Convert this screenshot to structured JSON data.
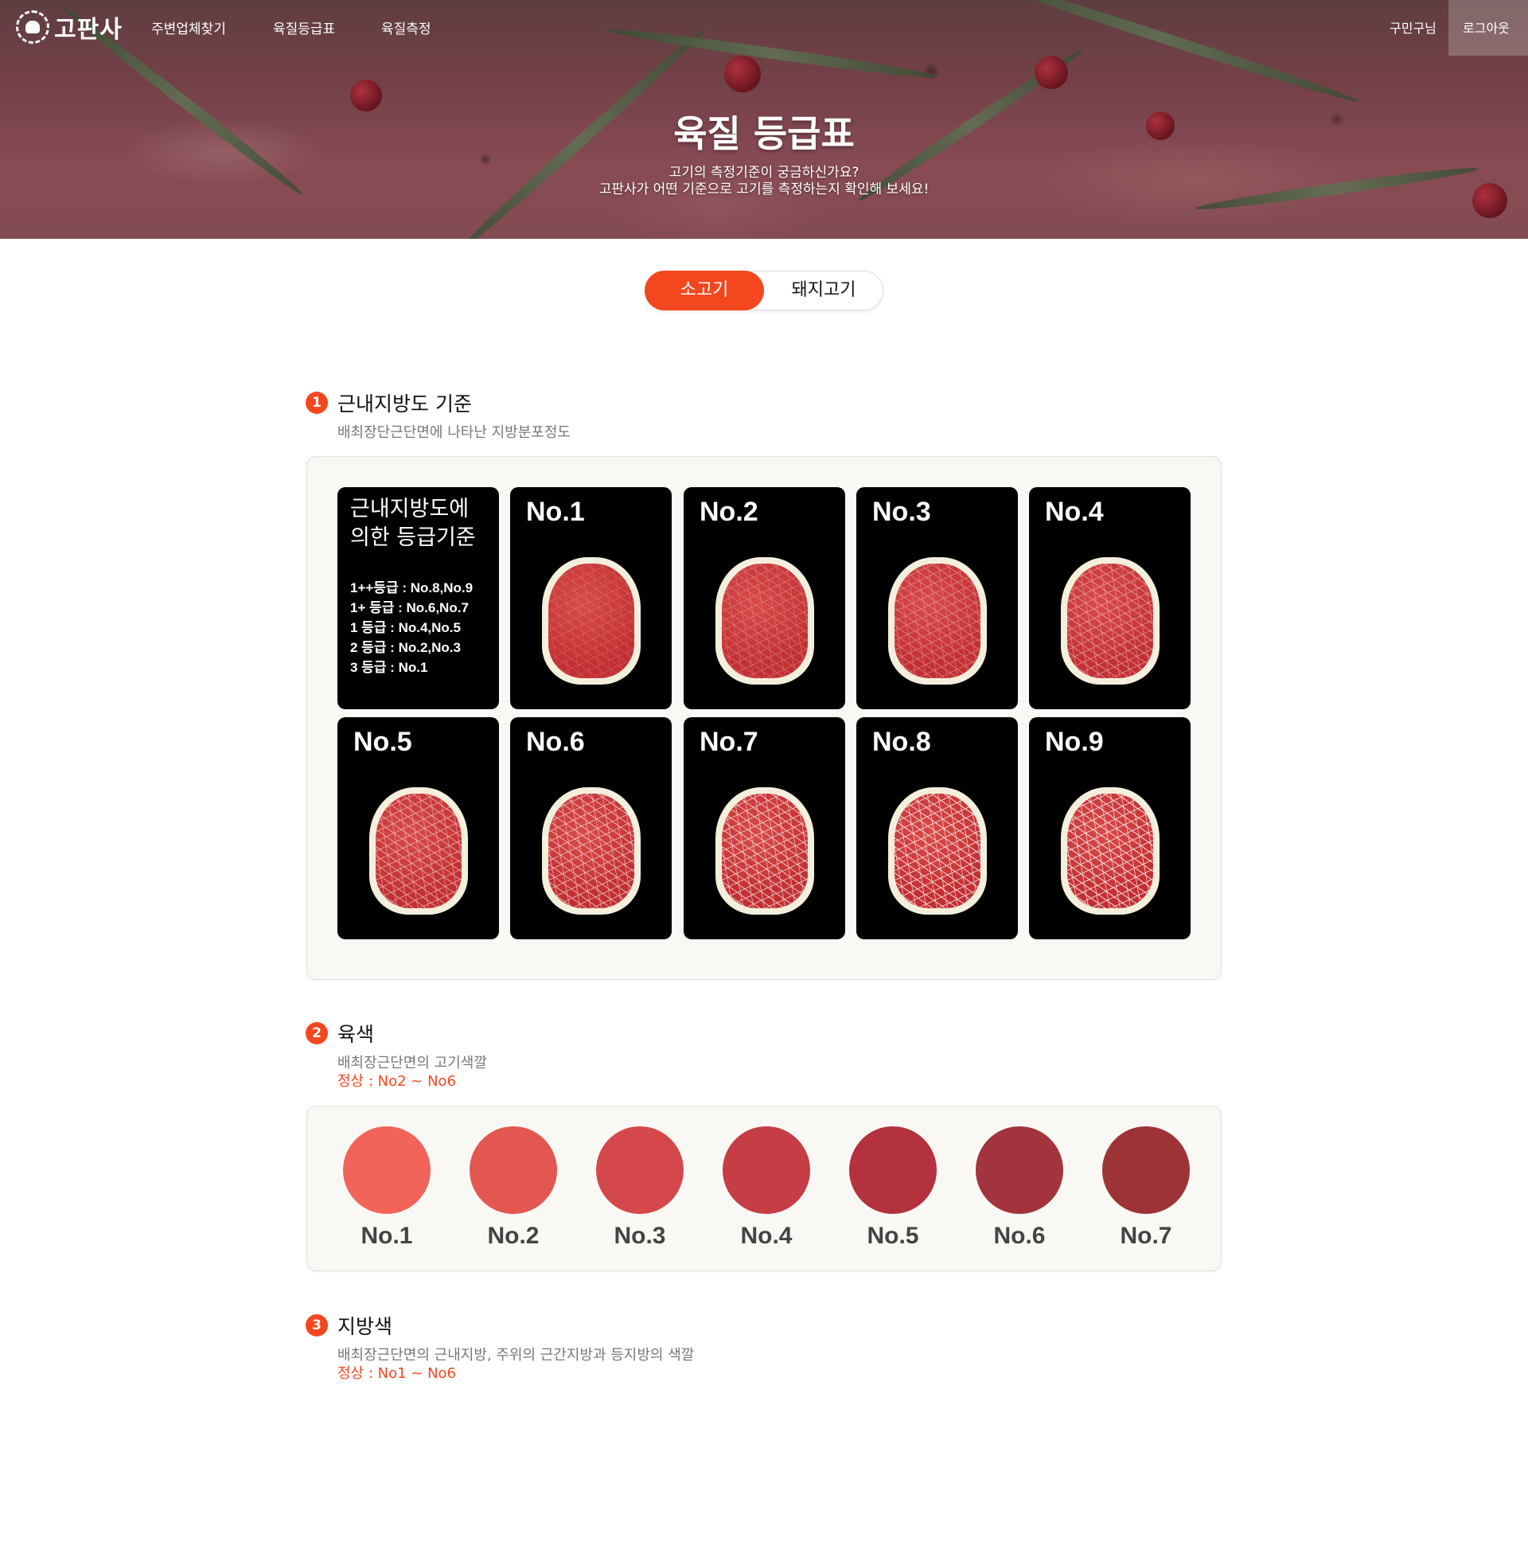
{
  "nav": {
    "logo_text": "고판사",
    "links": [
      "주변업체찾기",
      "육질등급표",
      "육질측정"
    ],
    "user": "구민구님",
    "logout": "로그아웃"
  },
  "hero": {
    "title": "육질 등급표",
    "sub1": "고기의 측정기준이 궁금하신가요?",
    "sub2": "고판사가 어떤 기준으로 고기를 측정하는지 확인해 보세요!"
  },
  "toggle": {
    "beef": "소고기",
    "pork": "돼지고기"
  },
  "section1": {
    "num": "1",
    "title": "근내지방도 기준",
    "desc": "배최장단근단면에 나타난 지방분포정도",
    "legend_title1": "근내지방도에",
    "legend_title2": "의한 등급기준",
    "legend_lines": [
      "1++등급 : No.8,No.9",
      "1+  등급 : No.6,No.7",
      "1    등급 : No.4,No.5",
      "2    등급 : No.2,No.3",
      "3    등급 : No.1"
    ],
    "cards": [
      {
        "label": "No.1",
        "level": 1
      },
      {
        "label": "No.2",
        "level": 2
      },
      {
        "label": "No.3",
        "level": 3
      },
      {
        "label": "No.4",
        "level": 4
      },
      {
        "label": "No.5",
        "level": 5
      },
      {
        "label": "No.6",
        "level": 6
      },
      {
        "label": "No.7",
        "level": 7
      },
      {
        "label": "No.8",
        "level": 8
      },
      {
        "label": "No.9",
        "level": 9
      }
    ]
  },
  "section2": {
    "num": "2",
    "title": "육색",
    "desc": "배최장근단면의 고기색깔",
    "note": "정상 : No2 ~ No6",
    "swatches": [
      {
        "label": "No.1",
        "color": "#f2645a"
      },
      {
        "label": "No.2",
        "color": "#e25851"
      },
      {
        "label": "No.3",
        "color": "#d4484b"
      },
      {
        "label": "No.4",
        "color": "#c63d45"
      },
      {
        "label": "No.5",
        "color": "#b4313e"
      },
      {
        "label": "No.6",
        "color": "#a3333c"
      },
      {
        "label": "No.7",
        "color": "#9e3337"
      }
    ]
  },
  "section3": {
    "num": "3",
    "title": "지방색",
    "desc": "배최장근단면의 근내지방, 주위의 근간지방과 등지방의 색깔",
    "note": "정상 : No1 ~ No6"
  },
  "colors": {
    "accent": "#f4471f"
  }
}
